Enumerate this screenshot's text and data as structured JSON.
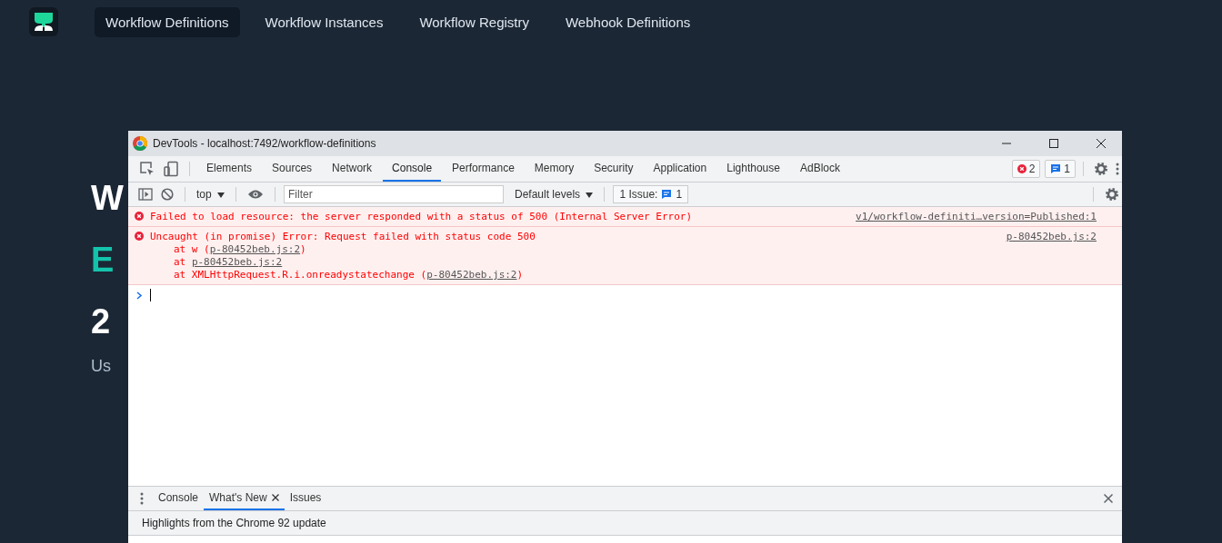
{
  "nav": {
    "items": [
      {
        "label": "Workflow Definitions",
        "selected": true
      },
      {
        "label": "Workflow Instances",
        "selected": false
      },
      {
        "label": "Workflow Registry",
        "selected": false
      },
      {
        "label": "Webhook Definitions",
        "selected": false
      }
    ]
  },
  "hero": {
    "lines": [
      {
        "text": "W",
        "kind": "title"
      },
      {
        "text": "E",
        "kind": "accent"
      },
      {
        "text": "2",
        "kind": "title"
      },
      {
        "text": "Us",
        "kind": "subtitle"
      }
    ]
  },
  "devtools": {
    "title": "DevTools - localhost:7492/workflow-definitions",
    "tabs": [
      {
        "label": "Elements",
        "selected": false
      },
      {
        "label": "Sources",
        "selected": false
      },
      {
        "label": "Network",
        "selected": false
      },
      {
        "label": "Console",
        "selected": true
      },
      {
        "label": "Performance",
        "selected": false
      },
      {
        "label": "Memory",
        "selected": false
      },
      {
        "label": "Security",
        "selected": false
      },
      {
        "label": "Application",
        "selected": false
      },
      {
        "label": "Lighthouse",
        "selected": false
      },
      {
        "label": "AdBlock",
        "selected": false
      }
    ],
    "error_count": "2",
    "message_count": "1",
    "context": "top",
    "filter_placeholder": "Filter",
    "levels": "Default levels",
    "issues_label": "1 Issue:",
    "issues_count": "1",
    "messages": [
      {
        "kind": "error",
        "text": "Failed to load resource: the server responded with a status of 500 (Internal Server Error)",
        "source": "v1/workflow-definiti…version=Published:1"
      },
      {
        "kind": "error",
        "text": "Uncaught (in promise) Error: Request failed with status code 500",
        "source": "p-80452beb.js:2",
        "stack": [
          {
            "prefix": "at w (",
            "link": "p-80452beb.js:2",
            "suffix": ")"
          },
          {
            "prefix": "at ",
            "link": "p-80452beb.js:2"
          },
          {
            "prefix": "at XMLHttpRequest.R.i.onreadystatechange (",
            "link": "p-80452beb.js:2",
            "suffix": ")"
          }
        ]
      }
    ],
    "drawer": {
      "tabs": [
        {
          "label": "Console",
          "selected": false,
          "closable": false
        },
        {
          "label": "What's New",
          "selected": true,
          "closable": true
        },
        {
          "label": "Issues",
          "selected": false,
          "closable": false
        }
      ],
      "headline": "Highlights from the Chrome 92 update"
    }
  }
}
